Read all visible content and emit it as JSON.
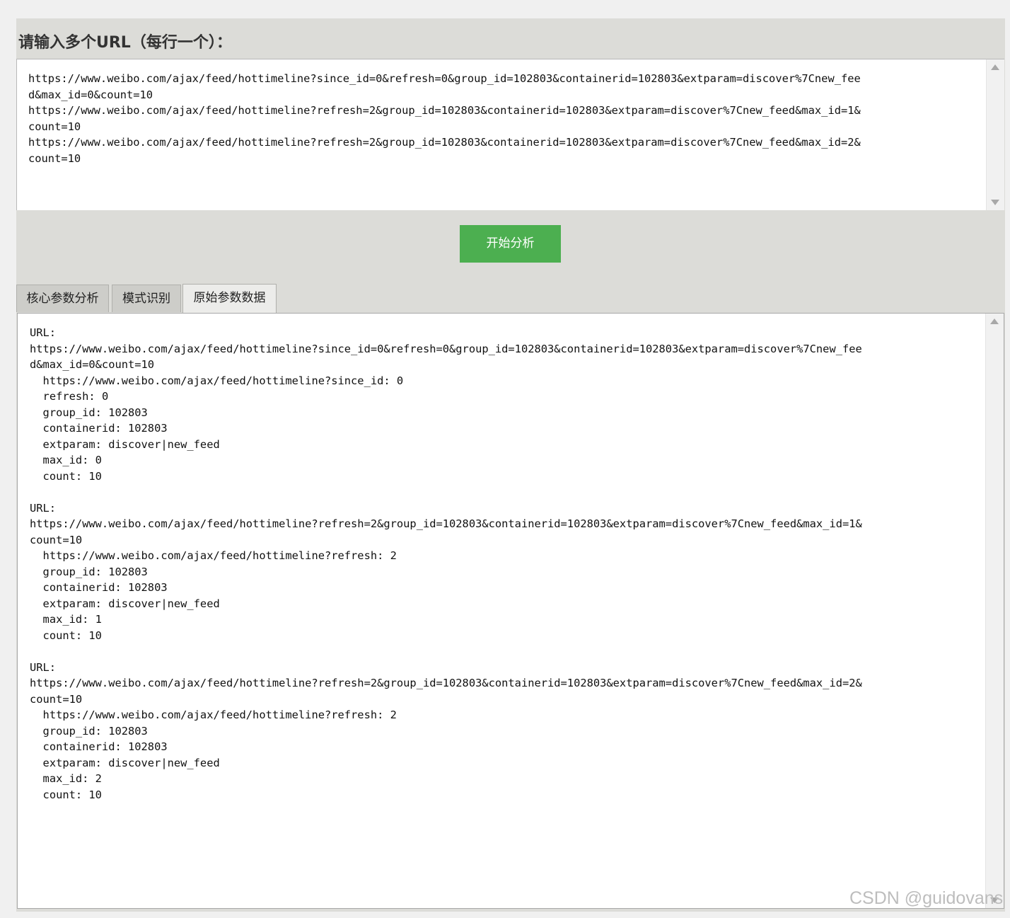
{
  "input_section": {
    "label": "请输入多个URL（每行一个）：",
    "value": "https://www.weibo.com/ajax/feed/hottimeline?since_id=0&refresh=0&group_id=102803&containerid=102803&extparam=discover%7Cnew_fee\nd&max_id=0&count=10\nhttps://www.weibo.com/ajax/feed/hottimeline?refresh=2&group_id=102803&containerid=102803&extparam=discover%7Cnew_feed&max_id=1&\ncount=10\nhttps://www.weibo.com/ajax/feed/hottimeline?refresh=2&group_id=102803&containerid=102803&extparam=discover%7Cnew_feed&max_id=2&\ncount=10"
  },
  "analyze_button": {
    "label": "开始分析",
    "color": "#4caf50"
  },
  "tabs": [
    {
      "label": "核心参数分析",
      "active": false
    },
    {
      "label": "模式识别",
      "active": false
    },
    {
      "label": "原始参数数据",
      "active": true
    }
  ],
  "results": [
    {
      "heading": "URL:",
      "url": "https://www.weibo.com/ajax/feed/hottimeline?since_id=0&refresh=0&group_id=102803&containerid=102803&extparam=discover%7Cnew_fee\nd&max_id=0&count=10",
      "params": [
        "https://www.weibo.com/ajax/feed/hottimeline?since_id: 0",
        "refresh: 0",
        "group_id: 102803",
        "containerid: 102803",
        "extparam: discover|new_feed",
        "max_id: 0",
        "count: 10"
      ]
    },
    {
      "heading": "URL:",
      "url": "https://www.weibo.com/ajax/feed/hottimeline?refresh=2&group_id=102803&containerid=102803&extparam=discover%7Cnew_feed&max_id=1&\ncount=10",
      "params": [
        "https://www.weibo.com/ajax/feed/hottimeline?refresh: 2",
        "group_id: 102803",
        "containerid: 102803",
        "extparam: discover|new_feed",
        "max_id: 1",
        "count: 10"
      ]
    },
    {
      "heading": "URL:",
      "url": "https://www.weibo.com/ajax/feed/hottimeline?refresh=2&group_id=102803&containerid=102803&extparam=discover%7Cnew_feed&max_id=2&\ncount=10",
      "params": [
        "https://www.weibo.com/ajax/feed/hottimeline?refresh: 2",
        "group_id: 102803",
        "containerid: 102803",
        "extparam: discover|new_feed",
        "max_id: 2",
        "count: 10"
      ]
    }
  ],
  "watermark": "CSDN @guidovans"
}
